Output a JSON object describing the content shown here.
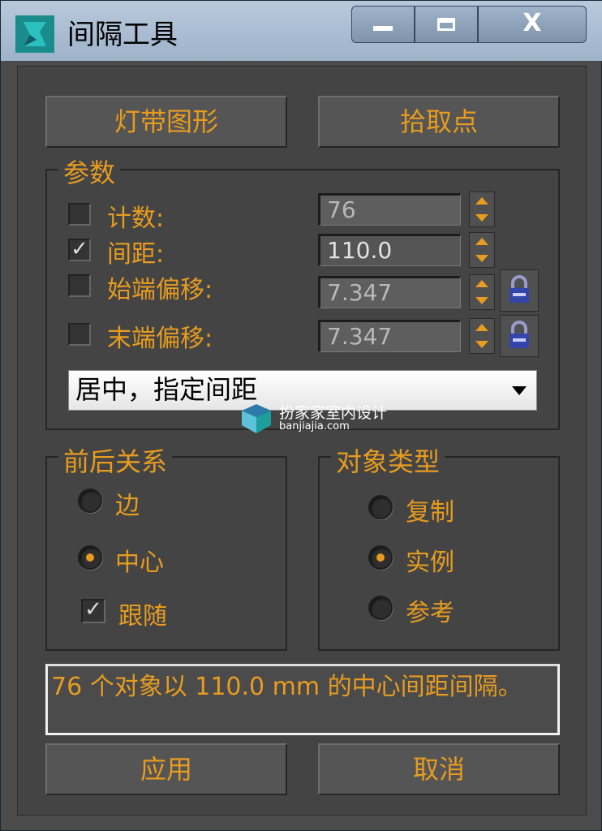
{
  "window": {
    "title": "间隔工具",
    "min_icon": "minimize-icon",
    "max_icon": "maximize-icon",
    "close_icon": "close-icon",
    "close_label": "X"
  },
  "top_buttons": {
    "spline": "灯带图形",
    "pick_points": "拾取点"
  },
  "params": {
    "title": "参数",
    "count": {
      "label": "计数:",
      "value": "76",
      "checked": false
    },
    "spacing": {
      "label": "间距:",
      "value": "110.0",
      "checked": true
    },
    "start_offset": {
      "label": "始端偏移:",
      "value": "7.347",
      "checked": false
    },
    "end_offset": {
      "label": "末端偏移:",
      "value": "7.347",
      "checked": false
    },
    "mode": "居中，指定间距"
  },
  "context": {
    "title": "前后关系",
    "edges": "边",
    "centers": "中心",
    "follow": "跟随",
    "selected": "中心",
    "follow_checked": true
  },
  "object_type": {
    "title": "对象类型",
    "copy": "复制",
    "instance": "实例",
    "reference": "参考",
    "selected": "实例"
  },
  "status": "76 个对象以 110.0 mm 的中心间距间隔。",
  "bottom_buttons": {
    "apply": "应用",
    "cancel": "取消"
  },
  "watermark": {
    "name": "扮家家室内设计",
    "url": "banjiajia.com"
  },
  "colors": {
    "accent": "#e79c1f",
    "panel": "#444444",
    "titlebar": "#a9bcd2"
  }
}
